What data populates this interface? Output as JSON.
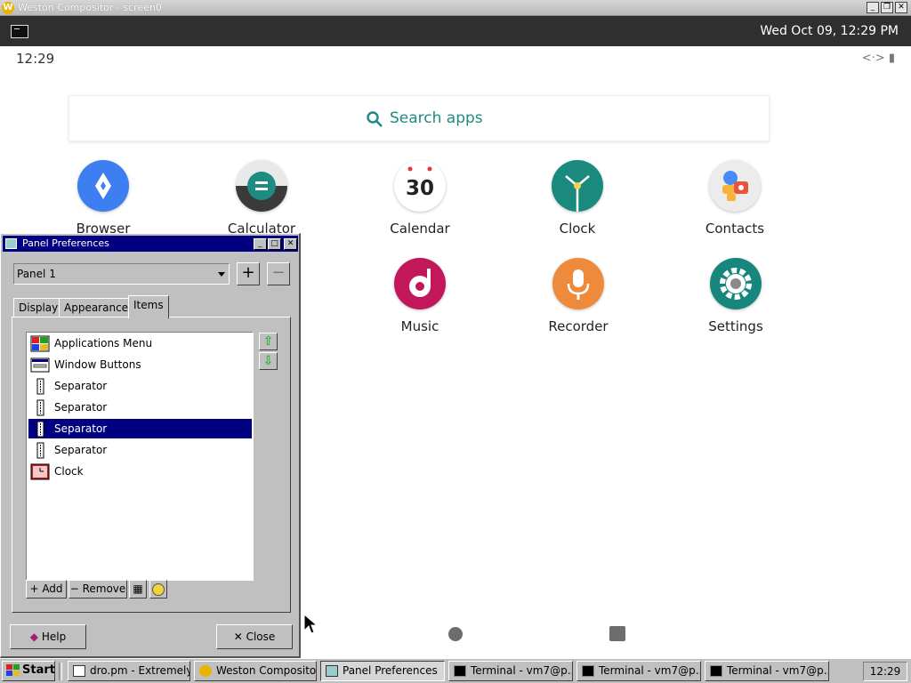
{
  "weston": {
    "title": "Weston Compositor - screen0",
    "clock": "Wed Oct 09, 12:29 PM"
  },
  "android": {
    "status_time": "12:29",
    "status_icons": "<·> ▮",
    "search_placeholder": "Search apps",
    "apps": [
      {
        "label": "Browser",
        "icon": "browser-icon",
        "color": "#3d7ff0"
      },
      {
        "label": "Calculator",
        "icon": "calculator-icon",
        "color": "#1e8c83"
      },
      {
        "label": "Calendar",
        "icon": "calendar-icon",
        "color": "#ffffff",
        "number": "30"
      },
      {
        "label": "Clock",
        "icon": "clock-icon",
        "color": "#1a8a7f"
      },
      {
        "label": "Contacts",
        "icon": "contacts-icon",
        "color": "#e8e8e8"
      },
      {
        "label": "Music",
        "icon": "music-icon",
        "color": "#c2185b"
      },
      {
        "label": "Recorder",
        "icon": "recorder-icon",
        "color": "#ee8a3b"
      },
      {
        "label": "Settings",
        "icon": "settings-icon",
        "color": "#17877d"
      }
    ]
  },
  "panel_prefs": {
    "title": "Panel Preferences",
    "panel_select": "Panel 1",
    "add_panel": "+",
    "remove_panel": "−",
    "tabs": [
      "Display",
      "Appearance",
      "Items"
    ],
    "active_tab": "Items",
    "items": [
      {
        "label": "Applications Menu",
        "icon": "applications-menu-icon"
      },
      {
        "label": "Window Buttons",
        "icon": "window-buttons-icon"
      },
      {
        "label": "Separator",
        "icon": "separator-icon"
      },
      {
        "label": "Separator",
        "icon": "separator-icon"
      },
      {
        "label": "Separator",
        "icon": "separator-icon",
        "selected": true
      },
      {
        "label": "Separator",
        "icon": "separator-icon"
      },
      {
        "label": "Clock",
        "icon": "clock-plugin-icon"
      }
    ],
    "add_label": "Add",
    "remove_label": "Remove",
    "help_label": "Help",
    "close_label": "Close"
  },
  "taskbar": {
    "start": "Start",
    "buttons": [
      {
        "label": "dro.pm - Extremely ...",
        "icon": "browser-window-icon"
      },
      {
        "label": "Weston Composito...",
        "icon": "weston-icon"
      },
      {
        "label": "Panel Preferences",
        "icon": "panel-prefs-icon",
        "active": true
      },
      {
        "label": "Terminal - vm7@p...",
        "icon": "terminal-icon"
      },
      {
        "label": "Terminal - vm7@p...",
        "icon": "terminal-icon"
      },
      {
        "label": "Terminal - vm7@p...",
        "icon": "terminal-icon"
      }
    ],
    "clock": "12:29"
  }
}
